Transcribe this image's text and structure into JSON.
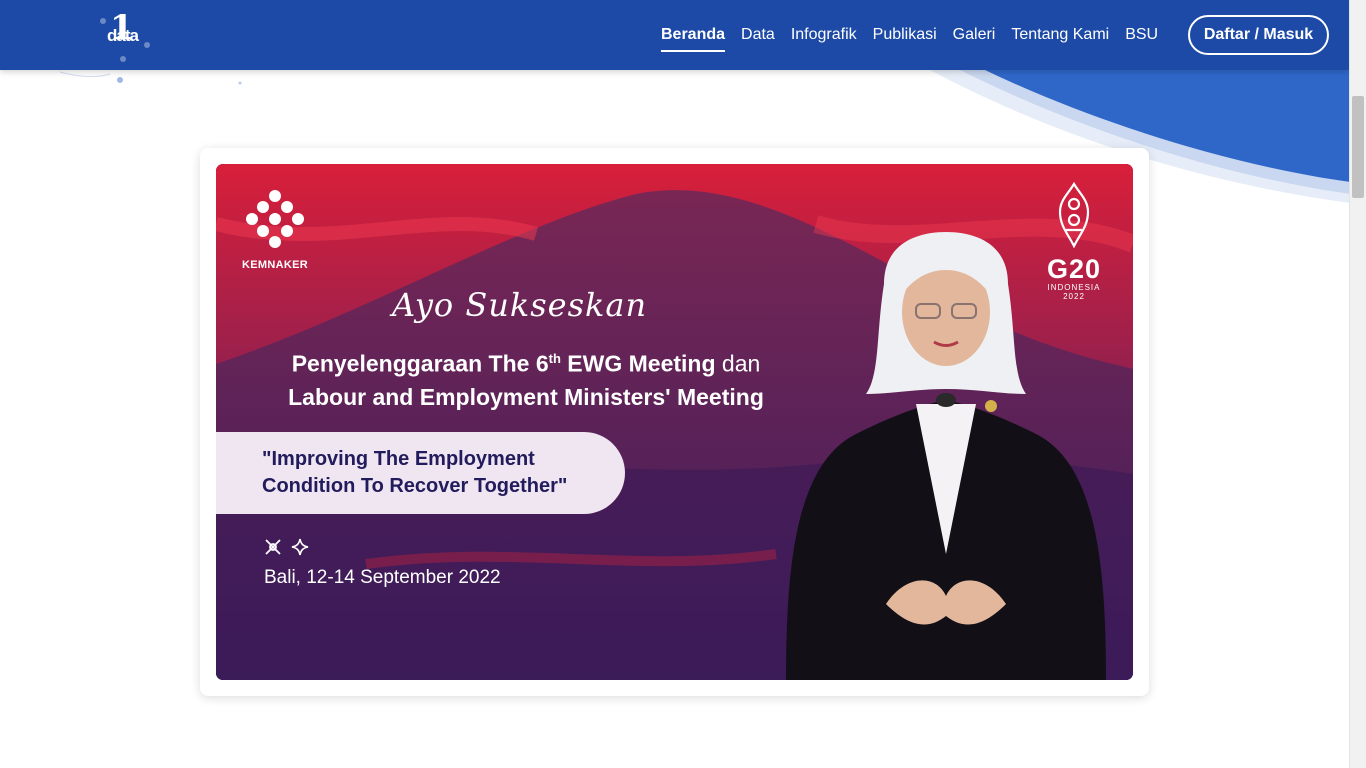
{
  "brand": {
    "logo_number": "1",
    "logo_text": "data"
  },
  "nav": {
    "items": [
      {
        "label": "Beranda",
        "active": true
      },
      {
        "label": "Data",
        "active": false
      },
      {
        "label": "Infografik",
        "active": false
      },
      {
        "label": "Publikasi",
        "active": false
      },
      {
        "label": "Galeri",
        "active": false
      },
      {
        "label": "Tentang Kami",
        "active": false
      },
      {
        "label": "BSU",
        "active": false
      }
    ],
    "login_label": "Daftar / Masuk"
  },
  "banner": {
    "org_label": "KEMNAKER",
    "g20_main": "G20",
    "g20_sub_1": "INDONESIA",
    "g20_sub_2": "2022",
    "script_title": "Ayo Sukseskan",
    "headline_part1": "Penyelenggaraan The 6",
    "headline_sup": "th",
    "headline_part2": " EWG Meeting ",
    "headline_part3": "dan",
    "headline_line2": "Labour and Employment Ministers' Meeting",
    "quote": "\"Improving The Employment Condition To Recover Together\"",
    "location_date": "Bali, 12-14 September 2022"
  },
  "colors": {
    "navbar": "#1d4aa7",
    "banner_red": "#d81f3a",
    "banner_purple": "#4a1f63",
    "quote_text": "#221c5c"
  },
  "icons": [
    "kemnaker-logo-icon",
    "g20-logo-icon",
    "batik-cross-icon",
    "sparkle-icon"
  ]
}
